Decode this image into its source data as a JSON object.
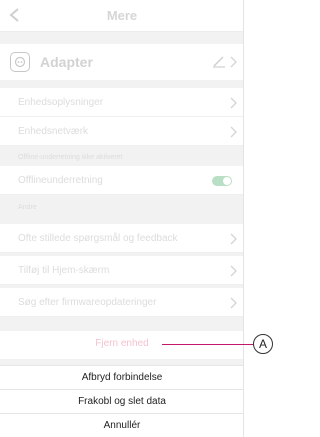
{
  "header": {
    "title": "Mere"
  },
  "device": {
    "name": "Adapter"
  },
  "settings": [
    {
      "label": "Enhedsoplysninger"
    },
    {
      "label": "Enhedsnetværk"
    }
  ],
  "offline_section": {
    "caption": "Offline-underretning ikke aktiveret",
    "item": {
      "label": "Offlineunderretning",
      "toggle_on": true
    }
  },
  "other_section": {
    "caption": "Andre",
    "items": [
      {
        "label": "Ofte stillede spørgsmål og feedback"
      },
      {
        "label": "Tilføj til Hjem-skærm"
      },
      {
        "label": "Søg efter firmwareopdateringer"
      }
    ]
  },
  "remove_device": {
    "label": "Fjern enhed"
  },
  "action_sheet": {
    "disconnect": "Afbryd forbindelse",
    "disconnect_wipe": "Frakobl og slet data",
    "cancel": "Annullér"
  },
  "callout": {
    "letter": "A"
  },
  "colors": {
    "callout": "#c2186b",
    "remove_text": "#f5c2cf",
    "toggle_on": "#b9dfc4"
  }
}
